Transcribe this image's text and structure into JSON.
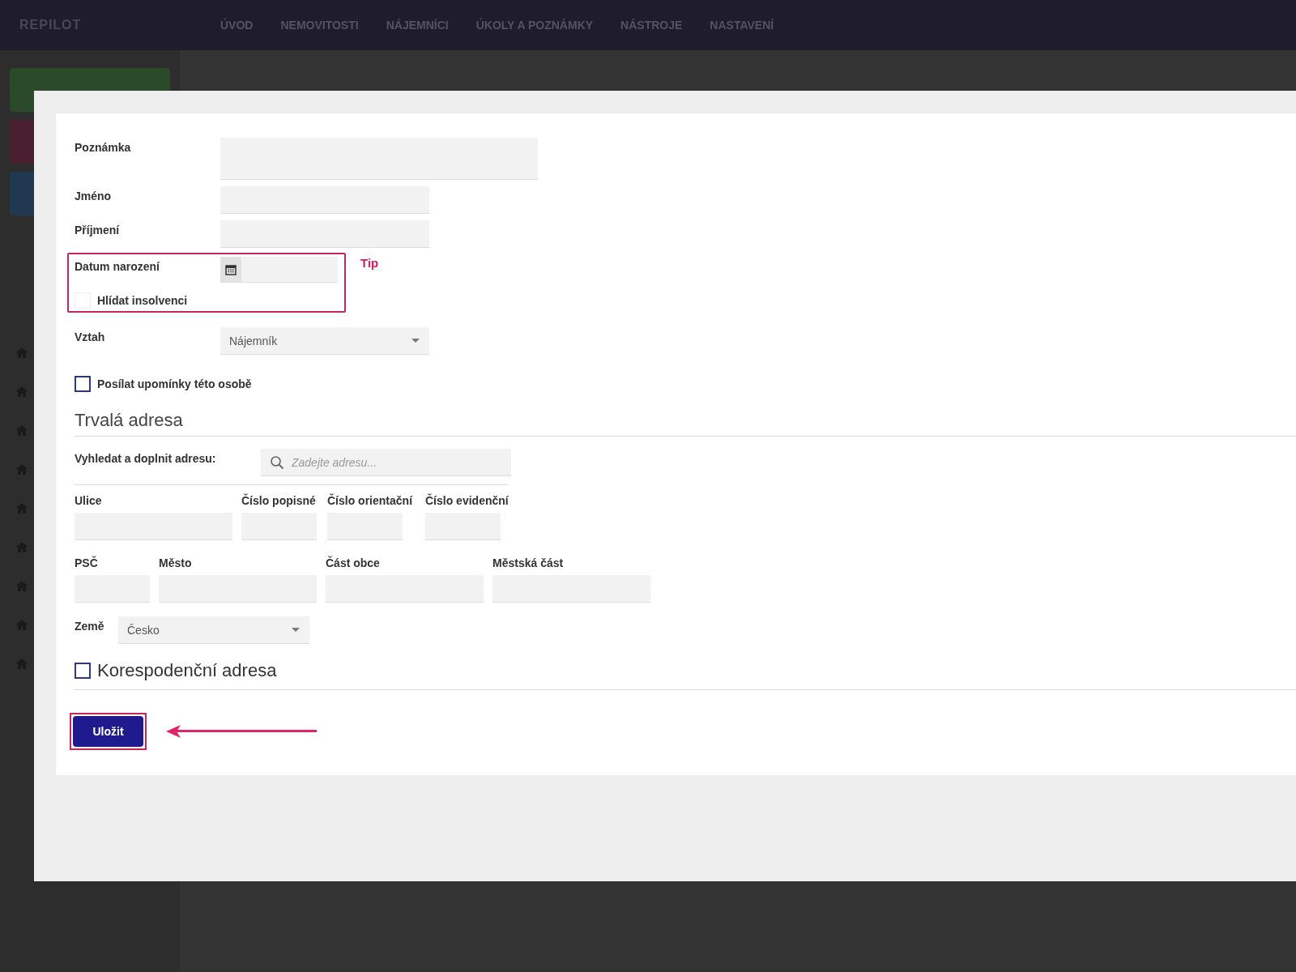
{
  "app": {
    "logo": "REPILOT",
    "nav": [
      {
        "label": "ÚVOD"
      },
      {
        "label": "NEMOVITOSTI"
      },
      {
        "label": "NÁJEMNÍCI"
      },
      {
        "label": "ÚKOLY A POZNÁMKY"
      },
      {
        "label": "NÁSTROJE"
      },
      {
        "label": "NASTAVENÍ"
      }
    ]
  },
  "form": {
    "note_label": "Poznámka",
    "first_name_label": "Jméno",
    "last_name_label": "Příjmení",
    "birth_date_label": "Datum narození",
    "insolvency": {
      "label": "Hlídat insolvenci",
      "checked": false
    },
    "relation": {
      "label": "Vztah",
      "value": "Nájemník"
    },
    "reminders": {
      "label": "Posílat upomínky této osobě",
      "checked": false
    },
    "address": {
      "heading": "Trvalá adresa",
      "search_label": "Vyhledat a doplnit adresu:",
      "search_placeholder": "Zadejte adresu...",
      "row_1": [
        {
          "label": "Ulice"
        },
        {
          "label": "Číslo popisné"
        },
        {
          "label": "Číslo orientační"
        },
        {
          "label": "Číslo evidenční"
        }
      ],
      "row_2": [
        {
          "label": "PSČ"
        },
        {
          "label": "Město"
        },
        {
          "label": "Část obce"
        },
        {
          "label": "Městská část"
        }
      ],
      "country": {
        "label": "Země",
        "value": "Česko"
      }
    },
    "correspondence": {
      "label": "Korespodenční adresa",
      "checked": false
    },
    "save_button": "Uložit"
  },
  "annotation": {
    "tip": "Tip"
  }
}
